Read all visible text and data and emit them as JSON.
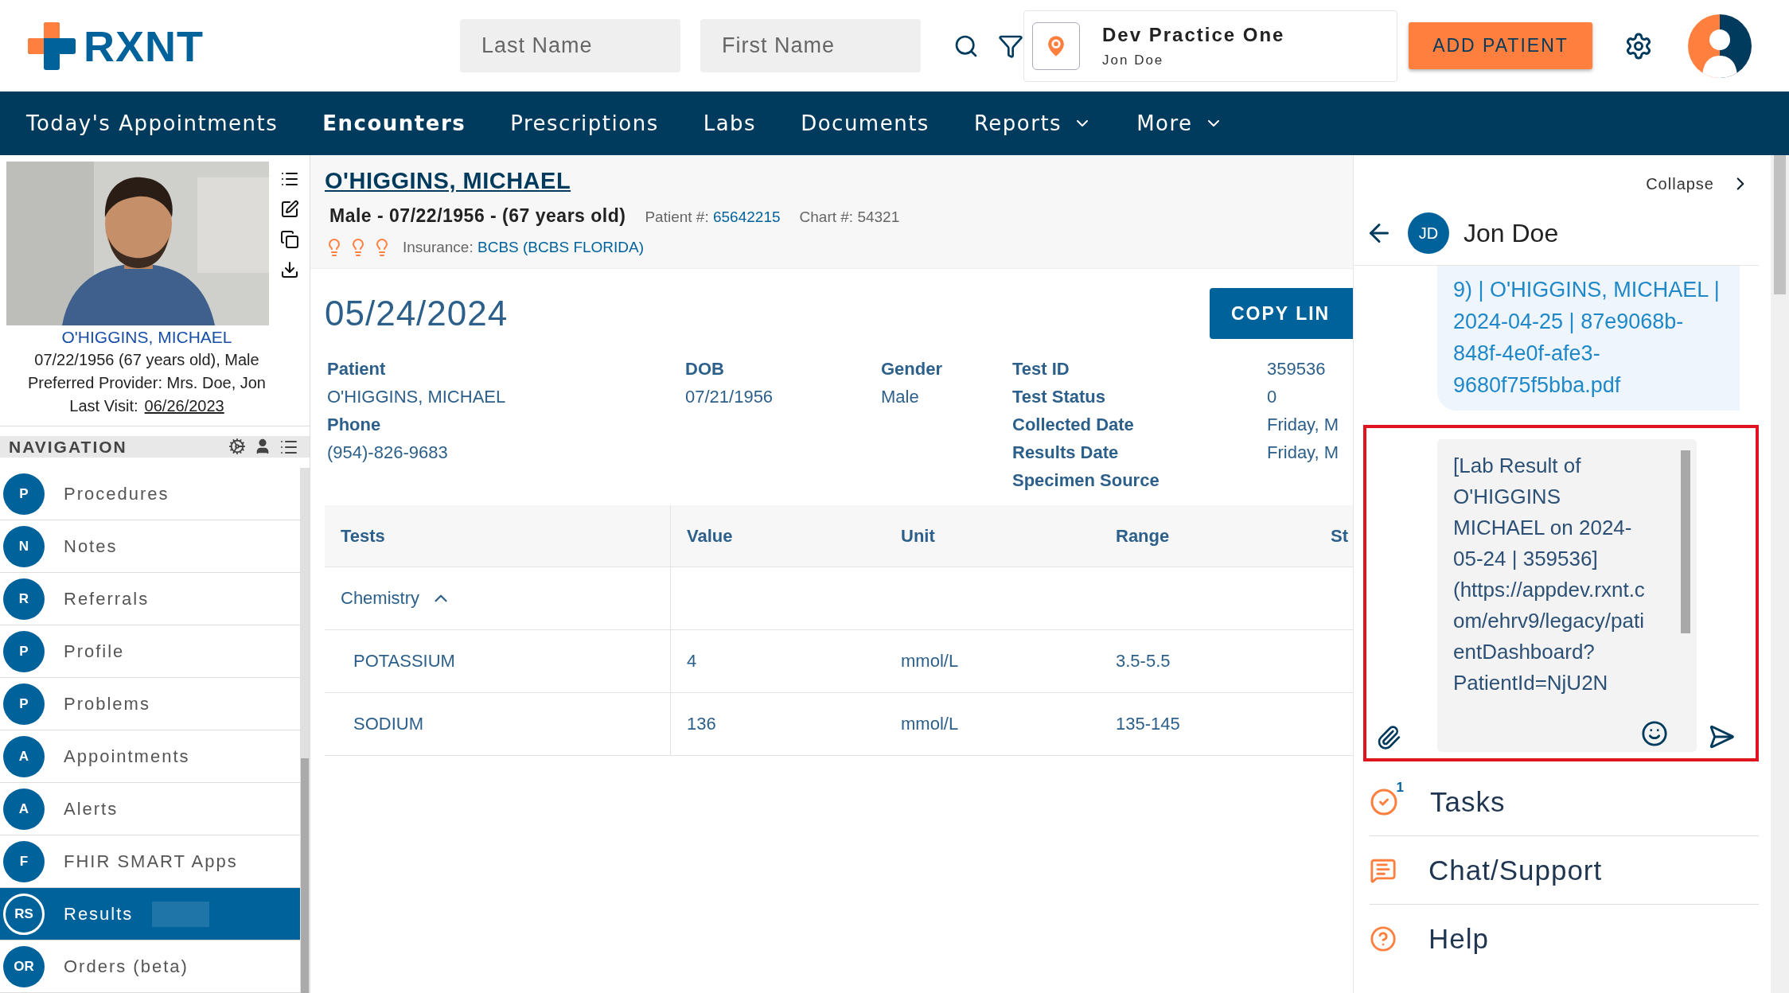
{
  "header": {
    "logo": "RXNT",
    "last_name": {
      "placeholder": "Last Name"
    },
    "first_name": {
      "placeholder": "First Name"
    },
    "practice": {
      "name": "Dev Practice One",
      "user": "Jon Doe"
    },
    "add_button": "ADD PATIENT"
  },
  "menu": [
    {
      "label": "Today's Appointments",
      "selected": false,
      "dropdown": false
    },
    {
      "label": "Encounters",
      "selected": true,
      "dropdown": false
    },
    {
      "label": "Prescriptions",
      "selected": false,
      "dropdown": false
    },
    {
      "label": "Labs",
      "selected": false,
      "dropdown": false
    },
    {
      "label": "Documents",
      "selected": false,
      "dropdown": false
    },
    {
      "label": "Reports",
      "selected": false,
      "dropdown": true
    },
    {
      "label": "More",
      "selected": false,
      "dropdown": true
    }
  ],
  "patient_card": {
    "name": "O'HIGGINS, MICHAEL",
    "details": "07/22/1956 (67 years old), Male",
    "provider": "Preferred Provider: Mrs. Doe, Jon",
    "last_visit_label": "Last Visit:",
    "last_visit": "06/26/2023"
  },
  "navigation": {
    "title": "NAVIGATION",
    "items": [
      {
        "initials": "P",
        "label": "Procedures",
        "selected": false
      },
      {
        "initials": "N",
        "label": "Notes",
        "selected": false
      },
      {
        "initials": "R",
        "label": "Referrals",
        "selected": false
      },
      {
        "initials": "P",
        "label": "Profile",
        "selected": false
      },
      {
        "initials": "P",
        "label": "Problems",
        "selected": false
      },
      {
        "initials": "A",
        "label": "Appointments",
        "selected": false
      },
      {
        "initials": "A",
        "label": "Alerts",
        "selected": false
      },
      {
        "initials": "F",
        "label": "FHIR SMART Apps",
        "selected": false
      },
      {
        "initials": "RS",
        "label": "Results",
        "selected": true
      },
      {
        "initials": "OR",
        "label": "Orders (beta)",
        "selected": false
      }
    ]
  },
  "patient_header": {
    "name": "O'HIGGINS, MICHAEL",
    "summary": "Male - 07/22/1956 - (67 years old)",
    "patient_label": "Patient #:",
    "patient_number": "65642215",
    "chart": "Chart #: 54321",
    "insurance_label": "Insurance:",
    "insurance": "BCBS (BCBS FLORIDA)"
  },
  "result": {
    "date": "05/24/2024",
    "copy_button": "COPY LIN",
    "patient_fields": [
      {
        "label": "Patient",
        "value": "O'HIGGINS, MICHAEL"
      },
      {
        "label": "Phone",
        "value": "(954)-826-9683"
      }
    ],
    "dob": {
      "label": "DOB",
      "value": "07/21/1956"
    },
    "gender": {
      "label": "Gender",
      "value": "Male"
    },
    "test_fields": [
      {
        "label": "Test ID",
        "value": "359536"
      },
      {
        "label": "Test Status",
        "value": "0"
      },
      {
        "label": "Collected Date",
        "value": "Friday, M"
      },
      {
        "label": "Results Date",
        "value": "Friday, M"
      },
      {
        "label": "Specimen Source"
      }
    ]
  },
  "table": {
    "columns": [
      "Tests",
      "Value",
      "Unit",
      "Range",
      "St"
    ],
    "groups": [
      {
        "name": "Chemistry",
        "expanded": true,
        "rows": [
          [
            "POTASSIUM",
            "4",
            "mmol/L",
            "3.5-5.5"
          ],
          [
            "SODIUM",
            "136",
            "mmol/L",
            "135-145"
          ]
        ]
      }
    ]
  },
  "chat": {
    "collapse": "Collapse",
    "contact_initials": "JD",
    "contact_name": "Jon Doe",
    "message": "9) | O'HIGGINS, MICHAEL | 2024-04-25 | 87e9068b-848f-4e0f-afe3-9680f75f5bba.pdf",
    "draft": "[Lab Result of O'HIGGINS MICHAEL on 2024-05-24 | 359536](https://appdev.rxnt.com/ehrv9/legacy/patientDashboard?PatientId=NjU2N",
    "links": [
      {
        "kind": "tasks",
        "label": "Tasks",
        "badge": "1"
      },
      {
        "kind": "chat",
        "label": "Chat/Support"
      },
      {
        "kind": "help",
        "label": "Help"
      }
    ]
  }
}
